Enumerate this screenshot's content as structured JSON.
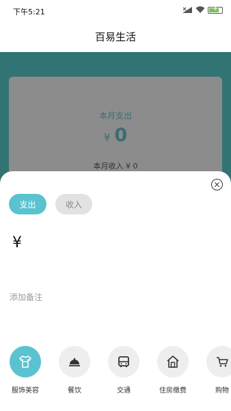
{
  "status": {
    "time": "下午5:21",
    "battery": "4"
  },
  "header": {
    "title": "百易生活"
  },
  "summary": {
    "label": "本月支出",
    "currency": "¥",
    "amount": "0",
    "income": "本月收入 ¥ 0"
  },
  "tabs": [
    {
      "label": "支出",
      "active": true
    },
    {
      "label": "收入",
      "active": false
    }
  ],
  "amount": {
    "currency": "¥"
  },
  "note": {
    "placeholder": "添加备注"
  },
  "categories": [
    {
      "label": "服饰美容",
      "icon": "shirt-icon",
      "active": true
    },
    {
      "label": "餐饮",
      "icon": "cloche-icon",
      "active": false
    },
    {
      "label": "交通",
      "icon": "bus-icon",
      "active": false
    },
    {
      "label": "住房缴费",
      "icon": "house-icon",
      "active": false
    },
    {
      "label": "购物",
      "icon": "cart-icon",
      "active": false
    }
  ],
  "colors": {
    "accent": "#5bc2cf",
    "background": "#327373"
  }
}
